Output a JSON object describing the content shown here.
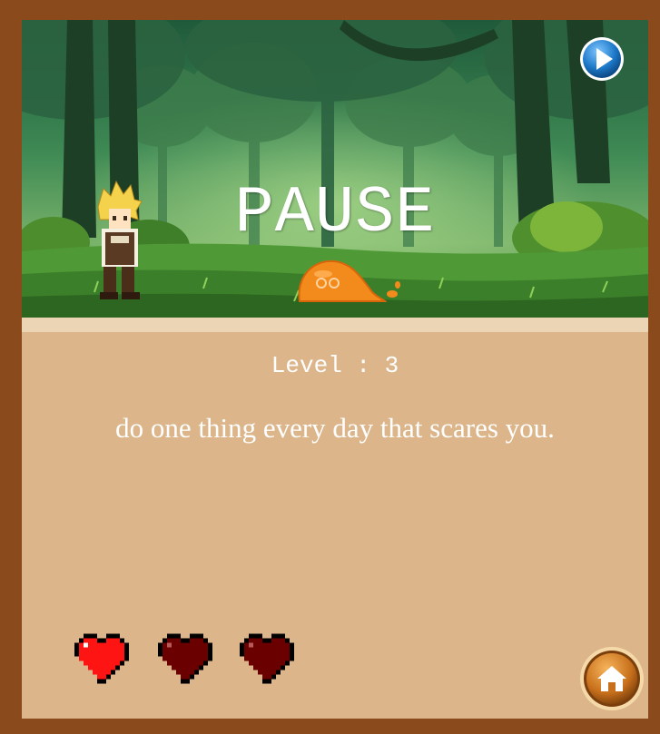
{
  "screen": {
    "title": "PAUSE",
    "level_label": "Level : 3",
    "quote": "do one thing every day that scares you."
  },
  "player": {
    "lives_total": 3,
    "lives_remaining": 1
  },
  "icons": {
    "resume": "play-icon",
    "home": "home-icon",
    "life": "heart-icon"
  },
  "colors": {
    "frame": "#8a4a1c",
    "panel": "#dcb68a",
    "panel_top_band": "#ecd5b4",
    "heart_full": "#ff1414",
    "heart_empty": "#6a0000",
    "play_button": "#1c78c8",
    "home_button": "#c8701c"
  }
}
